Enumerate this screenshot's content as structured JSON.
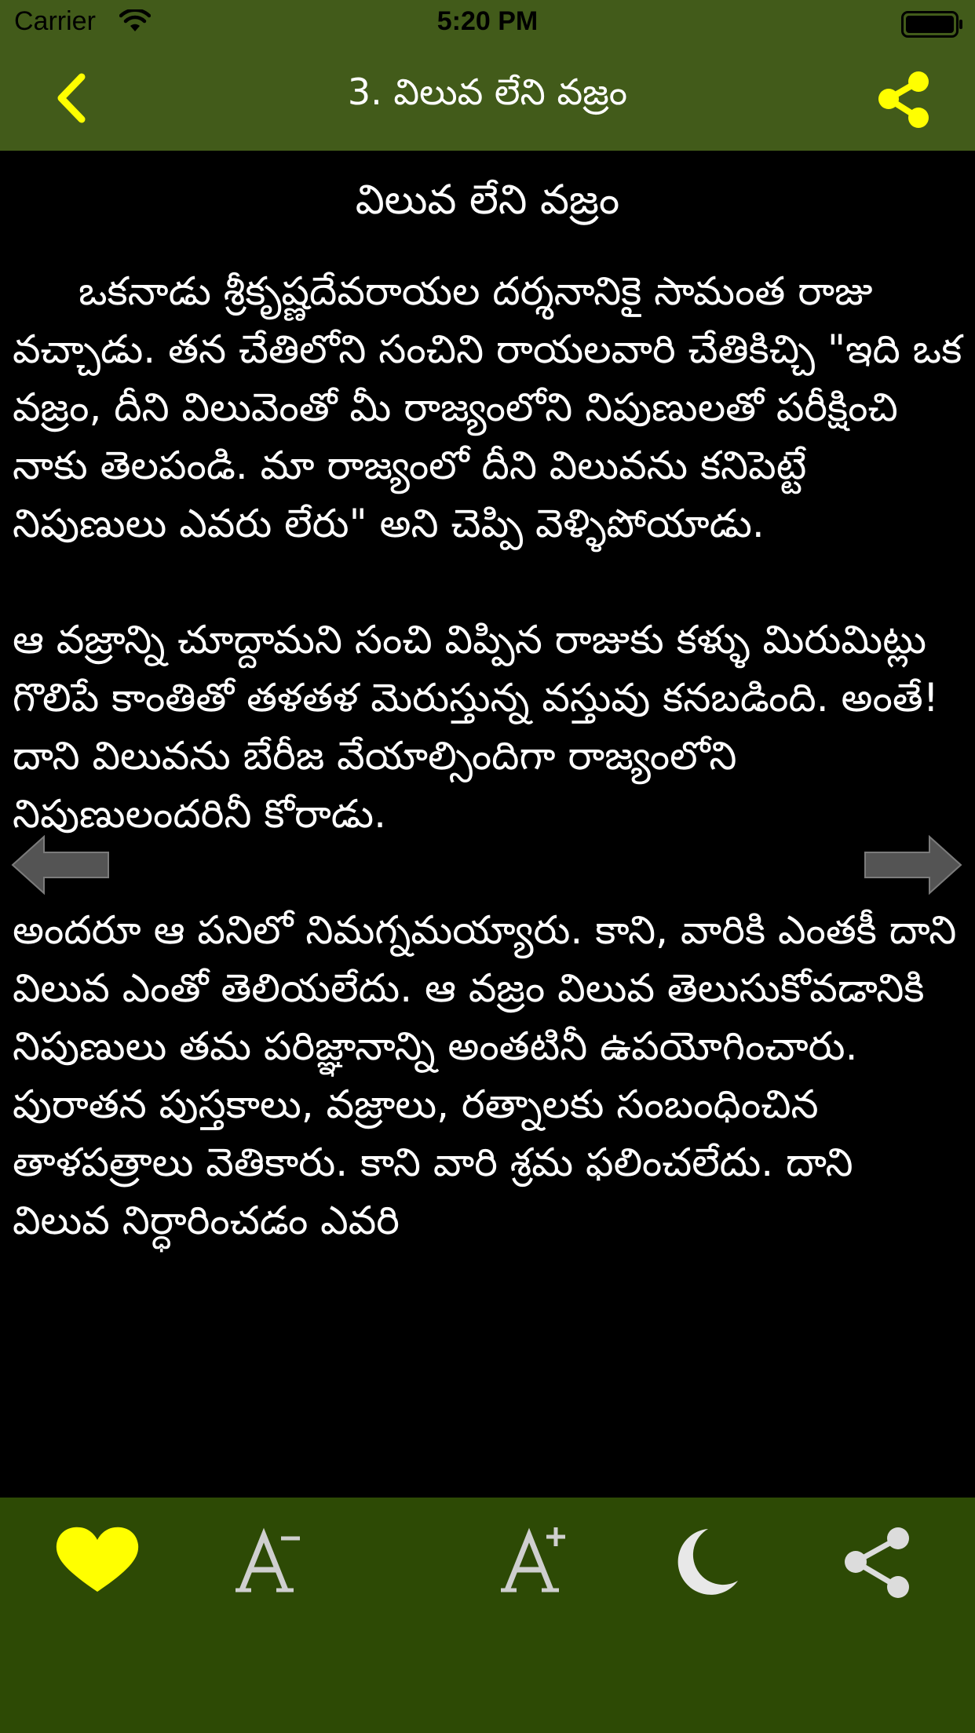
{
  "status_bar": {
    "carrier": "Carrier",
    "time": "5:20 PM"
  },
  "nav_bar": {
    "title": "3. విలువ లేని వజ్రం"
  },
  "story": {
    "title": "విలువ లేని వజ్రం",
    "paragraphs": [
      "ఒకనాడు శ్రీకృష్ణదేవరాయల దర్శనానికై సామంత రాజు వచ్చాడు. తన చేతిలోని సంచిని రాయలవారి చేతికిచ్చి \"ఇది ఒక వజ్రం, దీని విలువెంతో మీ రాజ్యంలోని నిపుణులతో పరీక్షించి నాకు తెలపండి. మా రాజ్యంలో దీని విలువను కనిపెట్టే నిపుణులు ఎవరు లేరు\" అని చెప్పి వెళ్ళిపోయాడు.",
      "ఆ వజ్రాన్ని చూద్దామని సంచి విప్పిన రాజుకు కళ్ళు మిరుమిట్లు గొలిపే కాంతితో తళతళ మెరుస్తున్న వస్తువు కనబడింది. అంతే! దాని విలువను బేరీజ వేయాల్సిందిగా రాజ్యంలోని నిపుణులందరినీ కోరాడు.",
      "అందరూ ఆ పనిలో నిమగ్నమయ్యారు. కాని, వారికి ఎంతకీ దాని విలువ ఎంతో తెలియలేదు. ఆ వజ్రం విలువ తెలుసుకోవడానికి నిపుణులు తమ పరిజ్ఞానాన్ని అంతటినీ ఉపయోగించారు. పురాతన పుస్తకాలు, వజ్రాలు, రత్నాలకు సంబంధించిన తాళపత్రాలు వెతికారు. కాని వారి శ్రమ ఫలించలేదు. దాని విలువ నిర్ధారించడం ఎవరి"
    ]
  },
  "icons": {
    "back": "chevron-left-icon",
    "share": "share-icon",
    "prev": "arrow-left-icon",
    "next": "arrow-right-icon",
    "favorite": "heart-icon",
    "font_smaller": "font-decrease-icon",
    "font_larger": "font-increase-icon",
    "night_mode": "moon-icon",
    "share_bottom": "share-icon"
  },
  "colors": {
    "bar_top": "#425b1a",
    "bar_bottom": "#2d4a05",
    "accent": "#ffff00",
    "text": "#ffffff",
    "background": "#000000"
  }
}
